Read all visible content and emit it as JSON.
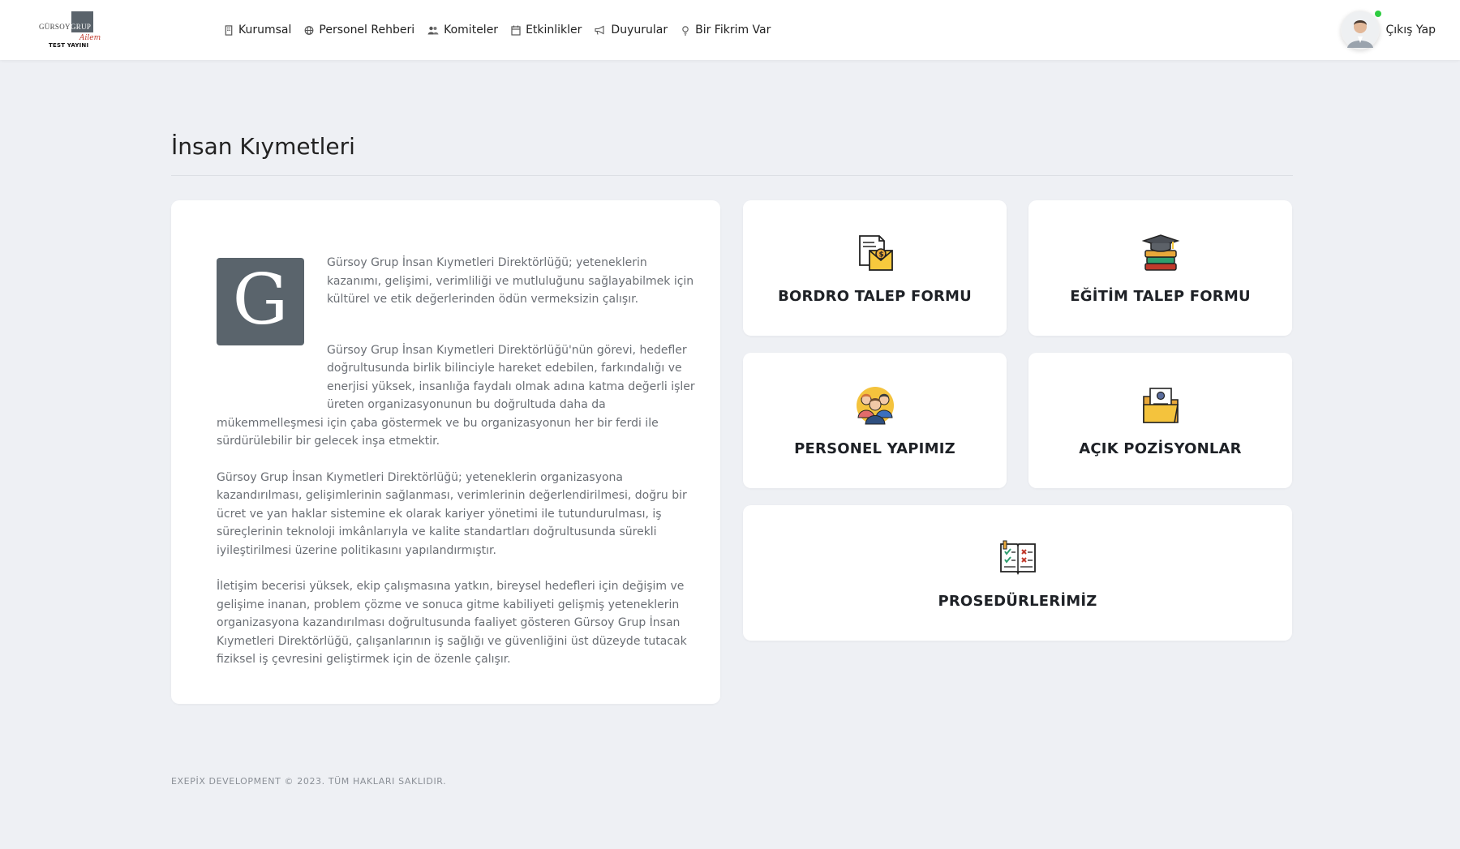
{
  "header": {
    "logo": {
      "word1": "GÜRSOY",
      "word2": "GRUP",
      "script": "Ailem",
      "subtitle": "TEST YAYINI"
    },
    "nav": [
      {
        "label": "Kurumsal",
        "icon": "building-icon"
      },
      {
        "label": "Personel Rehberi",
        "icon": "globe-icon"
      },
      {
        "label": "Komiteler",
        "icon": "users-icon"
      },
      {
        "label": "Etkinlikler",
        "icon": "calendar-icon"
      },
      {
        "label": "Duyurular",
        "icon": "megaphone-icon"
      },
      {
        "label": "Bir Fikrim Var",
        "icon": "lightbulb-icon"
      }
    ],
    "user": {
      "logout_label": "Çıkış Yap",
      "online_color": "#2ecc40"
    }
  },
  "page": {
    "title": "İnsan Kıymetleri"
  },
  "about": {
    "logo_letter": "G",
    "paragraphs": [
      "Gürsoy Grup İnsan Kıymetleri Direktörlüğü; yeteneklerin kazanımı, gelişimi, verimliliği ve mutluluğunu sağlayabilmek için kültürel ve etik değerlerinden ödün vermeksizin çalışır.",
      "Gürsoy Grup İnsan Kıymetleri Direktörlüğü'nün görevi, hedefler doğrultusunda birlik bilinciyle hareket edebilen, farkındalığı ve enerjisi yüksek, insanlığa faydalı olmak adına katma değerli işler üreten organizasyonunun bu doğrultuda daha da mükemmelleşmesi için çaba göstermek ve bu organizasyonun her bir ferdi ile sürdürülebilir bir gelecek inşa etmektir.",
      "Gürsoy Grup İnsan Kıymetleri Direktörlüğü; yeteneklerin organizasyona kazandırılması, gelişimlerinin sağlanması, verimlerinin değerlendirilmesi, doğru bir ücret ve yan haklar sistemine ek olarak kariyer yönetimi ile tutundurulması, iş süreçlerinin teknoloji imkânlarıyla ve kalite standartları doğrultusunda sürekli iyileştirilmesi üzerine politikasını yapılandırmıştır.",
      "İletişim becerisi yüksek, ekip çalışmasına yatkın, bireysel hedefleri için değişim ve gelişime inanan, problem çözme ve sonuca gitme kabiliyeti gelişmiş yeteneklerin organizasyona kazandırılması doğrultusunda faaliyet gösteren Gürsoy Grup İnsan Kıymetleri Direktörlüğü, çalışanlarının iş sağlığı ve güvenliğini üst düzeyde tutacak fiziksel iş çevresini geliştirmek için de özenle çalışır."
    ]
  },
  "tiles": [
    {
      "label": "BORDRO TALEP FORMU",
      "icon": "payroll-envelope-icon"
    },
    {
      "label": "EĞİTİM TALEP FORMU",
      "icon": "graduation-books-icon"
    },
    {
      "label": "PERSONEL YAPIMIZ",
      "icon": "team-people-icon"
    },
    {
      "label": "AÇIK POZİSYONLAR",
      "icon": "resume-folder-icon"
    },
    {
      "label": "PROSEDÜRLERİMİZ",
      "icon": "checklist-book-icon"
    }
  ],
  "footer": {
    "text": "EXEPİX DEVELOPMENT © 2023. TÜM HAKLARI SAKLIDIR."
  }
}
